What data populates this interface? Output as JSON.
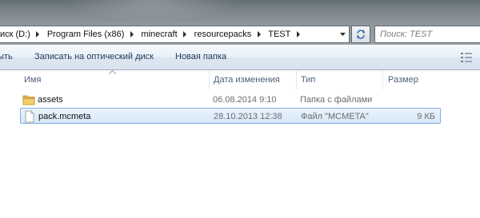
{
  "address": {
    "segments": [
      "иск (D:)",
      "Program Files (x86)",
      "minecraft",
      "resourcepacks",
      "TEST"
    ]
  },
  "search": {
    "placeholder": "Поиск: TEST"
  },
  "commands": {
    "partial_left": "ыть",
    "burn": "Записать на оптический диск",
    "new_folder": "Новая папка"
  },
  "columns": {
    "name": "Имя",
    "date": "Дата изменения",
    "type": "Тип",
    "size": "Размер"
  },
  "files": [
    {
      "name": "assets",
      "date": "06.08.2014 9:10",
      "type": "Папка с файлами",
      "size": "",
      "icon": "folder-icon",
      "selected": false
    },
    {
      "name": "pack.mcmeta",
      "date": "28.10.2013 12:38",
      "type": "Файл \"MCMETA\"",
      "size": "9 КБ",
      "icon": "file-icon",
      "selected": true
    }
  ],
  "colors": {
    "selection_border": "#84acdd",
    "selection_fill": "#d6e8fa",
    "command_text": "#1e395b"
  }
}
